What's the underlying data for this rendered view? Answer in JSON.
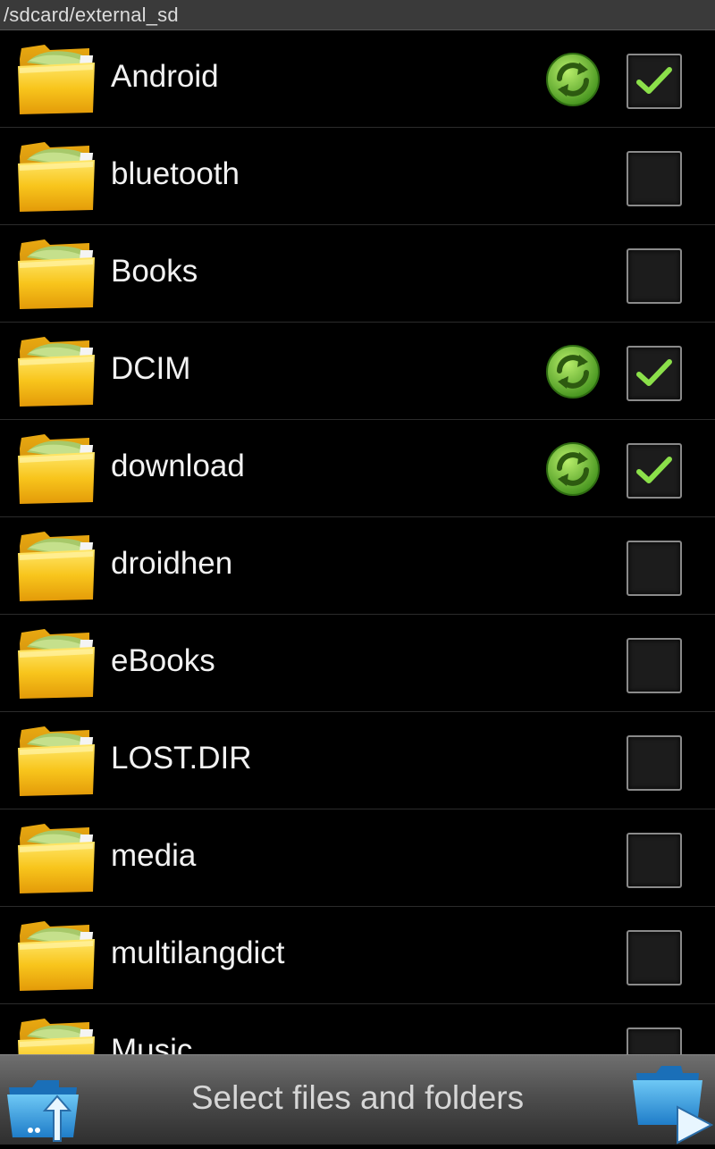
{
  "path": "/sdcard/external_sd",
  "folders": [
    {
      "name": "Android",
      "checked": true,
      "synced": true
    },
    {
      "name": "bluetooth",
      "checked": false,
      "synced": false
    },
    {
      "name": "Books",
      "checked": false,
      "synced": false
    },
    {
      "name": "DCIM",
      "checked": true,
      "synced": true
    },
    {
      "name": "download",
      "checked": true,
      "synced": true
    },
    {
      "name": "droidhen",
      "checked": false,
      "synced": false
    },
    {
      "name": "eBooks",
      "checked": false,
      "synced": false
    },
    {
      "name": "LOST.DIR",
      "checked": false,
      "synced": false
    },
    {
      "name": "media",
      "checked": false,
      "synced": false
    },
    {
      "name": "multilangdict",
      "checked": false,
      "synced": false
    },
    {
      "name": "Music",
      "checked": false,
      "synced": false
    }
  ],
  "bottom_bar": {
    "title": "Select files and folders",
    "left_icon": "folder-up-icon",
    "right_icon": "folder-next-icon"
  },
  "icons": {
    "folder": "folder-icon",
    "sync": "sync-icon",
    "check": "checkmark-icon"
  },
  "colors": {
    "background": "#000000",
    "path_bar": "#3a3a3a",
    "folder_yellow": "#f6c21a",
    "sync_green": "#7cc73a",
    "check_green": "#8be04a",
    "divider": "#2b2b2b"
  }
}
